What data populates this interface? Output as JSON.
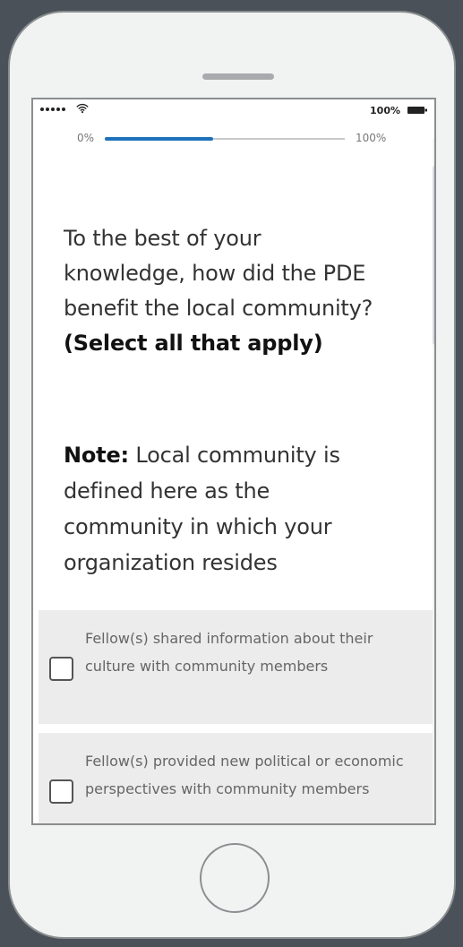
{
  "status_bar": {
    "battery_text": "100%"
  },
  "progress": {
    "start_label": "0%",
    "end_label": "100%",
    "value_percent": 45
  },
  "question": {
    "text": "To the best of your knowledge, how did the PDE benefit the local community?",
    "instruction": "(Select all that apply)"
  },
  "note": {
    "label": "Note:",
    "text": "Local community is defined here as the community in which your organization resides"
  },
  "options": [
    {
      "label": "Fellow(s) shared information about their culture with community members",
      "checked": false
    },
    {
      "label": "Fellow(s) provided new political or economic perspectives with community members",
      "checked": false
    }
  ],
  "icons": {
    "wifi": "wifi-icon",
    "battery": "battery-icon",
    "checkbox": "checkbox"
  },
  "colors": {
    "progress_fill": "#1d73ba",
    "device_frame": "#f1f2f2",
    "page_background": "#4a5158"
  }
}
